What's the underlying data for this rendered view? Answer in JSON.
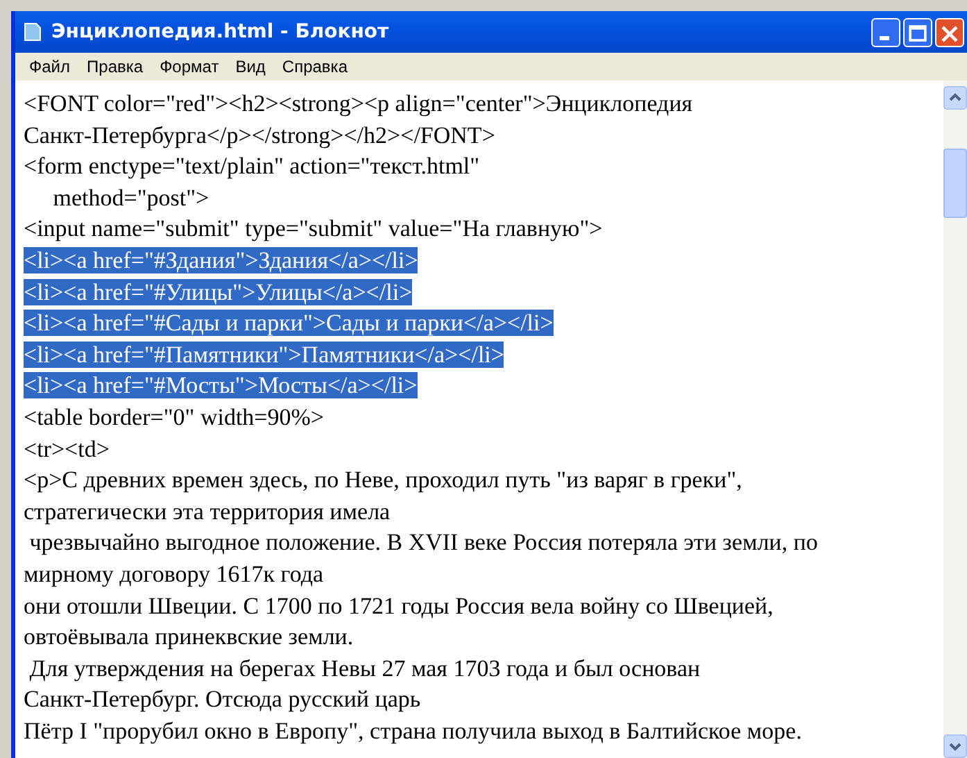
{
  "window": {
    "title": "Энциклопедия.html - Блокнот"
  },
  "menu": [
    "Файл",
    "Правка",
    "Формат",
    "Вид",
    "Справка"
  ],
  "lines": [
    {
      "text": "<FONT color=\"red\"><h2><strong><p align=\"center\">Энциклопедия",
      "selected": false
    },
    {
      "text": "Санкт-Петербурга</p></strong></h2></FONT>",
      "selected": false
    },
    {
      "text": "<form enctype=\"text/plain\" action=\"текст.html\"",
      "selected": false
    },
    {
      "text": "     method=\"post\">",
      "selected": false
    },
    {
      "text": "<input name=\"submit\" type=\"submit\" value=\"На главную\">",
      "selected": false
    },
    {
      "text": "<li><a href=\"#Здания\">Здания</a></li>",
      "selected": true
    },
    {
      "text": "<li><a href=\"#Улицы\">Улицы</a></li>",
      "selected": true
    },
    {
      "text": "<li><a href=\"#Сады и парки\">Сады и парки</a></li>",
      "selected": true
    },
    {
      "text": "<li><a href=\"#Памятники\">Памятники</a></li>",
      "selected": true
    },
    {
      "text": "<li><a href=\"#Мосты\">Мосты</a></li>",
      "selected": true
    },
    {
      "text": "<table border=\"0\" width=90%>",
      "selected": false
    },
    {
      "text": "<tr><td>",
      "selected": false
    },
    {
      "text": "<p>С древних времен здесь, по Неве, проходил путь \"из варяг в греки\",",
      "selected": false
    },
    {
      "text": "стратегически эта территория имела",
      "selected": false
    },
    {
      "text": " чрезвычайно выгодное положение. В XVII веке Россия потеряла эти земли, по",
      "selected": false
    },
    {
      "text": "мирному договору 1617к года",
      "selected": false
    },
    {
      "text": "они отошли Швеции. С 1700 по 1721 годы Россия вела войну со Швецией,",
      "selected": false
    },
    {
      "text": "овтоёвывала принеквские земли.",
      "selected": false
    },
    {
      "text": " Для утверждения на берегах Невы 27 мая 1703 года и был основан",
      "selected": false
    },
    {
      "text": "Санкт-Петербург. Отсюда русский царь",
      "selected": false
    },
    {
      "text": "Пётр I \"прорубил окно в Европу\", страна получила выход в Балтийское море.",
      "selected": false
    }
  ]
}
